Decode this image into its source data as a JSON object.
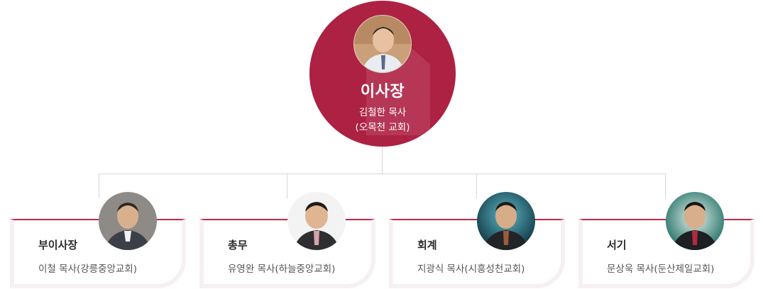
{
  "chairman": {
    "title": "이사장",
    "name": "김철한 목사",
    "church": "(오목천 교회)"
  },
  "members": [
    {
      "title": "부이사장",
      "name": "이철 목사(강릉중앙교회)"
    },
    {
      "title": "총무",
      "name": "유영완 목사(하늘중앙교회)"
    },
    {
      "title": "회계",
      "name": "지광식 목사(시흥성천교회)"
    },
    {
      "title": "서기",
      "name": "문상욱 목사(둔산제일교회)"
    }
  ],
  "colors": {
    "accent": "#ad2142",
    "card_border": "#c02a47",
    "card_shadow": "#f7f0f1",
    "line": "#d6d6d6"
  }
}
